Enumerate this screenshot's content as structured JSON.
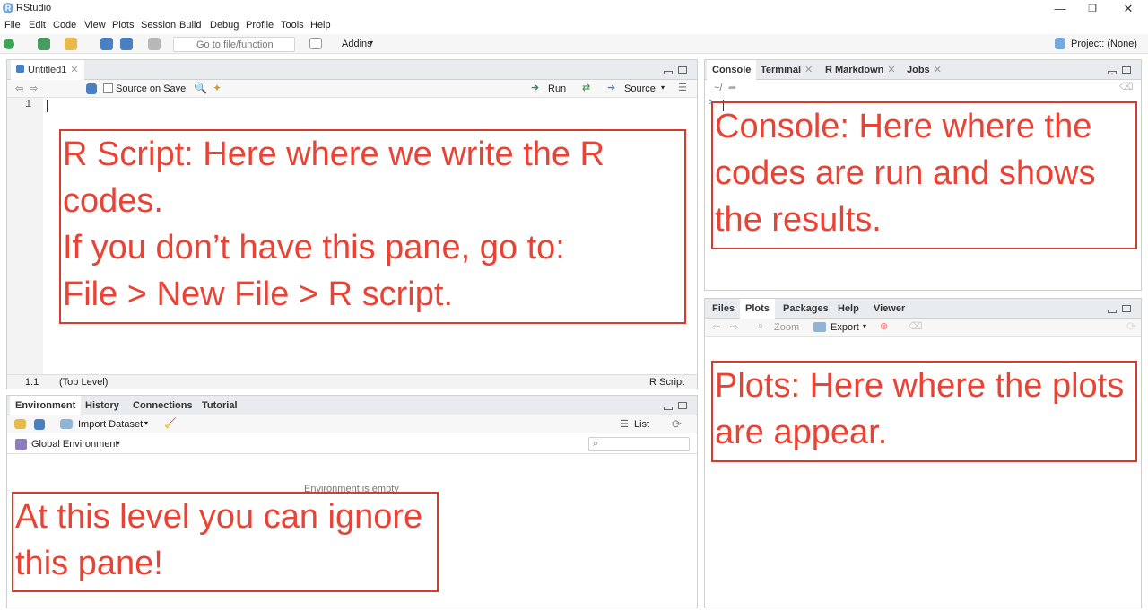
{
  "window": {
    "title": "RStudio",
    "logo": "R",
    "minimize": "—",
    "restore": "❐",
    "close": "✕"
  },
  "menu": [
    "File",
    "Edit",
    "Code",
    "View",
    "Plots",
    "Session",
    "Build",
    "Debug",
    "Profile",
    "Tools",
    "Help"
  ],
  "toolbar": {
    "goto_placeholder": "Go to file/function",
    "addins": "Addins",
    "project": "Project: (None)"
  },
  "editor": {
    "tab_label": "Untitled1",
    "source_on_save": "Source on Save",
    "run": "Run",
    "source": "Source",
    "line_number": "1",
    "status_position": "1:1",
    "status_scope": "(Top Level)",
    "status_type": "R Script"
  },
  "console_pane": {
    "tabs": [
      "Console",
      "Terminal",
      "R Markdown",
      "Jobs"
    ],
    "path": "~/",
    "prompt": ">"
  },
  "files_pane": {
    "tabs": [
      "Files",
      "Plots",
      "Packages",
      "Help",
      "Viewer"
    ],
    "zoom": "Zoom",
    "export": "Export"
  },
  "env_pane": {
    "tabs": [
      "Environment",
      "History",
      "Connections",
      "Tutorial"
    ],
    "import_dataset": "Import Dataset",
    "list": "List",
    "global_env": "Global Environment",
    "empty": "Environment is empty"
  },
  "annotations": {
    "script": "R Script: Here where we write the R codes.\nIf you don’t have this pane, go to:\nFile > New File > R script.",
    "console": "Console: Here where the codes are run and shows the results.",
    "plots": "Plots: Here where the plots are appear.",
    "env": "At this level you can ignore this pane!"
  },
  "colors": {
    "annotation": "#e84335",
    "accent": "#75aadb"
  }
}
